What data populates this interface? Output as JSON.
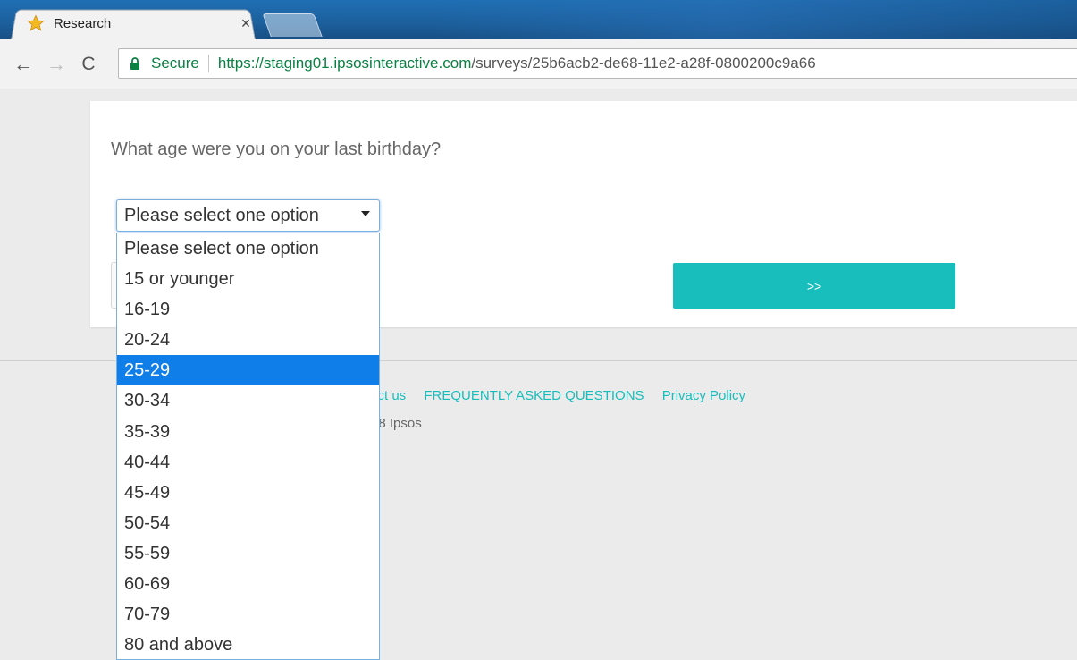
{
  "browser": {
    "tab": {
      "title": "Research",
      "favicon": "star-icon",
      "close": "×"
    },
    "nav": {
      "back": "←",
      "forward": "→",
      "reload": "C"
    },
    "address": {
      "secure_label": "Secure",
      "url_host": "https://staging01.ipsosinteractive.com",
      "url_path": "/surveys/25b6acb2-de68-11e2-a28f-0800200c9a66"
    }
  },
  "survey": {
    "question": "What age were you on your last birthday?",
    "select": {
      "value": "Please select one option",
      "options": [
        "Please select one option",
        "15 or younger",
        "16-19",
        "20-24",
        "25-29",
        "30-34",
        "35-39",
        "40-44",
        "45-49",
        "50-54",
        "55-59",
        "60-69",
        "70-79",
        "80 and above"
      ],
      "highlighted": "25-29"
    },
    "next_button": ">>"
  },
  "footer": {
    "links": [
      "tact us",
      "FREQUENTLY ASKED QUESTIONS",
      "Privacy Policy"
    ],
    "copyright": ")18 Ipsos"
  },
  "colors": {
    "accent": "#17bebb",
    "highlight": "#0f7ee8",
    "secure_green": "#0b8043"
  }
}
